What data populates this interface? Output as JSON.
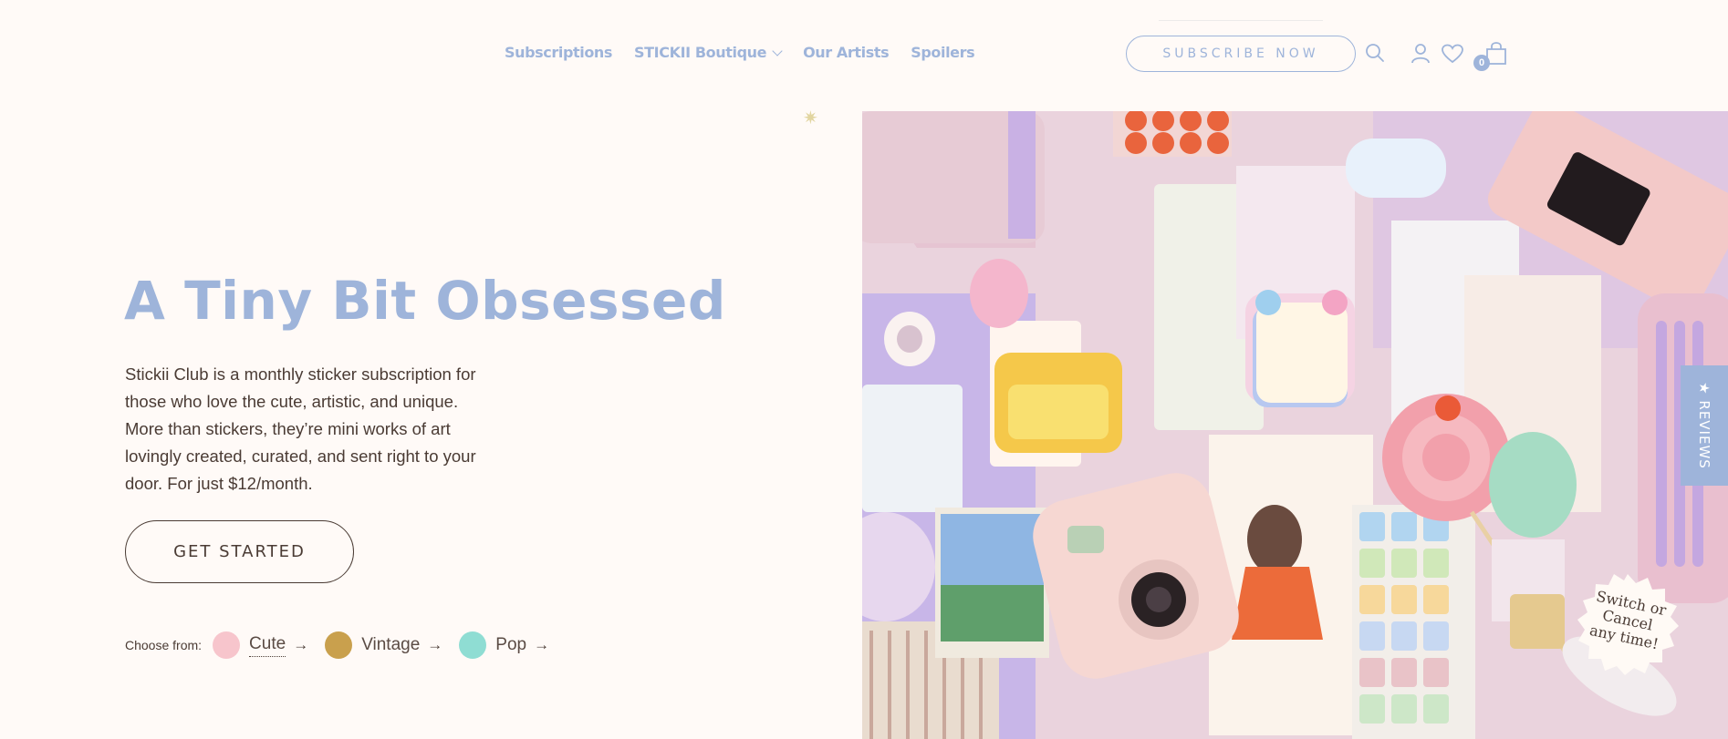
{
  "nav": {
    "items": [
      {
        "label": "Subscriptions"
      },
      {
        "label": "STICKII Boutique"
      },
      {
        "label": "Our Artists"
      },
      {
        "label": "Spoilers"
      }
    ]
  },
  "header": {
    "subscribe_label": "SUBSCRIBE NOW",
    "cart_count": "0",
    "icons": [
      "search-icon",
      "account-icon",
      "wishlist-heart-icon",
      "cart-bag-icon"
    ]
  },
  "hero": {
    "title": "A Tiny Bit Obsessed",
    "description": "Stickii Club is a monthly sticker subscription for those who love the cute, artistic, and unique. More than stickers, they’re mini works of art lovingly created, curated, and sent right to your door. For just $12/month.",
    "cta_label": "GET STARTED",
    "choose_label": "Choose from:",
    "styles": [
      {
        "label": "Cute",
        "color": "#f7c5cc"
      },
      {
        "label": "Vintage",
        "color": "#c9a04d"
      },
      {
        "label": "Pop",
        "color": "#8fddd3"
      }
    ]
  },
  "side_tab": {
    "label": "★ REVIEWS"
  },
  "badge": {
    "line1": "Switch or",
    "line2": "Cancel",
    "line3": "any time!"
  },
  "colors": {
    "accent": "#9eb4da",
    "text": "#4a3b34",
    "background": "#fffaf7"
  }
}
